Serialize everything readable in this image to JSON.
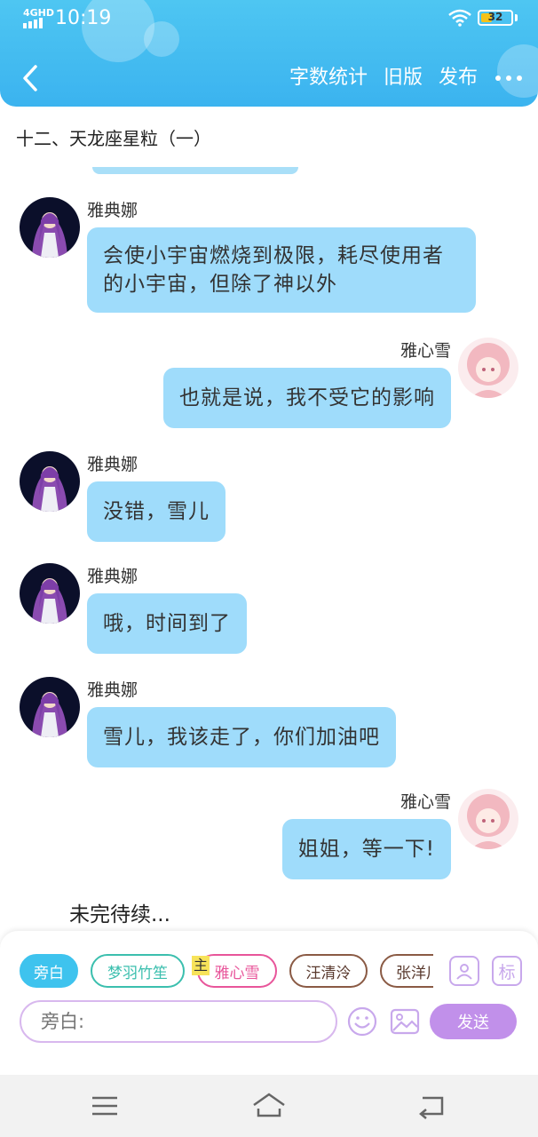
{
  "status_bar": {
    "network": "4GHD",
    "time": "10:19",
    "battery": "32"
  },
  "header": {
    "actions": [
      {
        "name": "word-count-button",
        "label": "字数统计"
      },
      {
        "name": "old-version-button",
        "label": "旧版"
      },
      {
        "name": "publish-button",
        "label": "发布"
      }
    ]
  },
  "chapter": {
    "title": "十二、天龙座星粒（一）"
  },
  "messages": [
    {
      "side": "left",
      "sender": "雅典娜",
      "text": "会使小宇宙燃烧到极限，耗尽使用者的小宇宙，但除了神以外"
    },
    {
      "side": "right",
      "sender": "雅心雪",
      "text": "也就是说，我不受它的影响"
    },
    {
      "side": "left",
      "sender": "雅典娜",
      "text": "没错，雪儿"
    },
    {
      "side": "left",
      "sender": "雅典娜",
      "text": "哦，时间到了"
    },
    {
      "side": "left",
      "sender": "雅典娜",
      "text": "雪儿，我该走了，你们加油吧"
    },
    {
      "side": "right",
      "sender": "雅心雪",
      "text": "姐姐，等一下!"
    }
  ],
  "tbc": "未完待续...",
  "composer": {
    "chips": [
      {
        "label": "旁白",
        "color": "#3ec3ee",
        "active": true
      },
      {
        "label": "梦羽竹笙",
        "color": "#3bbfae",
        "active": false
      },
      {
        "label": "雅心雪",
        "color": "#e8559a",
        "active": false
      },
      {
        "label": "汪清泠",
        "color": "#8a5a44",
        "active": false
      },
      {
        "label": "张洋川",
        "color": "#8a5a44",
        "active": false
      }
    ],
    "main_tag": "主",
    "mark_icon_label": "标",
    "input_placeholder": "旁白:",
    "send_label": "发送"
  },
  "colors": {
    "header": "#3bb3ef",
    "bubble": "#9fdcfb",
    "send": "#c190ea"
  }
}
